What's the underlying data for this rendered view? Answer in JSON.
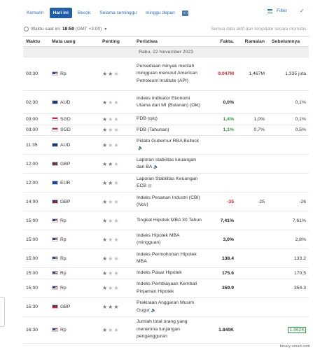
{
  "tabs": [
    "Kemarin",
    "Hari ini",
    "Besok",
    "Selama seminggu",
    "minggu depan"
  ],
  "filter_label": "Filter",
  "time": {
    "prefix": "Waktu saat ini:",
    "value": "18:59",
    "zone": "(GMT +3:00)"
  },
  "note": "Semua data aktif dan terupdate secara otomatis.",
  "headers": [
    "Waktu",
    "Mata uang",
    "Penting",
    "Peristiwa",
    "Fakta.",
    "Ramalan",
    "Sebelumnya"
  ],
  "date_label": "Rabu, 22 November 2023",
  "rows": [
    {
      "time": "00:30",
      "currency": "Rp",
      "flag": "us",
      "importance": 2,
      "event": "Persediaan minyak mentah mingguan menurut American Petroleum Institute (API)",
      "actual": "9.047M",
      "actual_style": "red",
      "forecast": "1,467M",
      "previous": "1,335 juta",
      "prev_style": ""
    },
    {
      "time": "02:30",
      "currency": "AUD",
      "flag": "au",
      "importance": 1,
      "event": "Indeks Indikator Ekonomi Utama dari MI (Bulanan) (Okt)",
      "actual": "0,0%",
      "actual_style": "bold",
      "forecast": "",
      "previous": "0,1%",
      "prev_style": ""
    },
    {
      "time": "03:00",
      "currency": "SGD",
      "flag": "sg",
      "importance": 1,
      "event": "PDB (q/q)",
      "actual": "1,4%",
      "actual_style": "green",
      "forecast": "1,0%",
      "previous": "0,1%",
      "prev_style": ""
    },
    {
      "time": "03:00",
      "currency": "SGD",
      "flag": "sg",
      "importance": 1,
      "event": "PDB (Tahunan)",
      "actual": "1,1%",
      "actual_style": "green",
      "forecast": "0,7%",
      "previous": "0,5%",
      "prev_style": ""
    },
    {
      "time": "11:35",
      "currency": "AUD",
      "flag": "au",
      "importance": 1,
      "event": "Pidato Gubernur RBA Bullock",
      "speaker": true,
      "actual": "",
      "actual_style": "",
      "forecast": "",
      "previous": "",
      "prev_style": ""
    },
    {
      "time": "12:00",
      "currency": "GBP",
      "flag": "gb",
      "importance": 2,
      "event": "Laporan stabilitas keuangan dari BA",
      "speaker": true,
      "actual": "",
      "actual_style": "",
      "forecast": "",
      "previous": "",
      "prev_style": ""
    },
    {
      "time": "12:00",
      "currency": "EUR",
      "flag": "eu",
      "importance": 2,
      "event": "Laporan Stabilitas Keuangan ECB",
      "doc": true,
      "actual": "",
      "actual_style": "",
      "forecast": "",
      "previous": "",
      "prev_style": ""
    },
    {
      "time": "14:00",
      "currency": "GBP",
      "flag": "gb",
      "importance": 1,
      "event": "Indeks Pesanan Industri (CBI) (Nov)",
      "actual": "-35",
      "actual_style": "red",
      "forecast": "-25",
      "previous": "-26",
      "prev_style": ""
    },
    {
      "time": "15:00",
      "currency": "Rp",
      "flag": "us",
      "importance": 1,
      "event": "Tingkat Hipotek MBA 30 Tahun",
      "actual": "7,41%",
      "actual_style": "bold",
      "forecast": "",
      "previous": "7,61%",
      "prev_style": ""
    },
    {
      "time": "15:00",
      "currency": "Rp",
      "flag": "us",
      "importance": 1,
      "event": "Indeks Hipotek MBA (mingguan)",
      "actual": "3,0%",
      "actual_style": "bold",
      "forecast": "",
      "previous": "2,8%",
      "prev_style": ""
    },
    {
      "time": "15:00",
      "currency": "Rp",
      "flag": "us",
      "importance": 1,
      "event": "Indeks Permohonan Hipotek MBA",
      "actual": "138.4",
      "actual_style": "bold",
      "forecast": "",
      "previous": "133.2",
      "prev_style": ""
    },
    {
      "time": "15:00",
      "currency": "Rp",
      "flag": "us",
      "importance": 1,
      "event": "Indeks Pasar Hipotek",
      "actual": "175.6",
      "actual_style": "bold",
      "forecast": "",
      "previous": "170,5",
      "prev_style": ""
    },
    {
      "time": "15:00",
      "currency": "Rp",
      "flag": "us",
      "importance": 1,
      "event": "Indeks Pembiayaan Kembali Pinjaman Hipotek",
      "actual": "359.9",
      "actual_style": "bold",
      "forecast": "",
      "previous": "354.3",
      "prev_style": ""
    },
    {
      "time": "15:30",
      "currency": "GBP",
      "flag": "gb",
      "importance": 3,
      "event": "Prakiraan Anggaran Musim Gugur",
      "speaker": true,
      "actual": "",
      "actual_style": "",
      "forecast": "",
      "previous": "",
      "prev_style": ""
    },
    {
      "time": "16:30",
      "currency": "Rp",
      "flag": "us",
      "importance": 1,
      "event": "Jumlah total orang yang menerima tunjangan pengangguran",
      "actual": "1.840K",
      "actual_style": "bold",
      "forecast": "",
      "previous": "1.862K",
      "prev_style": "green-out"
    }
  ],
  "watermark": "binary-smart.com"
}
